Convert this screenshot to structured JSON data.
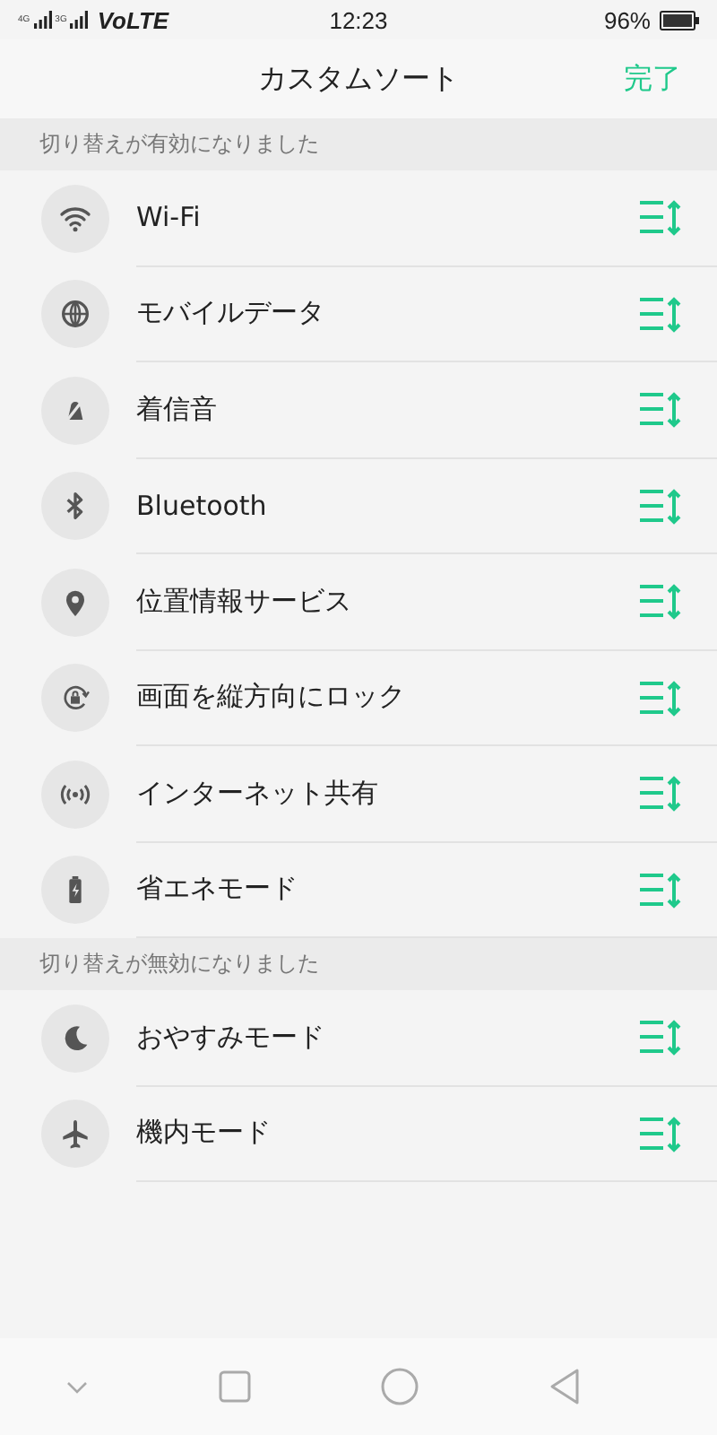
{
  "status_bar": {
    "network_1": "4G",
    "network_2": "3G",
    "carrier": "VoLTE",
    "time": "12:23",
    "battery": "96%"
  },
  "header": {
    "title": "カスタムソート",
    "done": "完了"
  },
  "sections": [
    {
      "title": "切り替えが有効になりました",
      "items": [
        {
          "label": "Wi-Fi",
          "kind": "wifi"
        },
        {
          "label": "モバイルデータ",
          "kind": "globe"
        },
        {
          "label": "着信音",
          "kind": "ringer"
        },
        {
          "label": "Bluetooth",
          "kind": "bluetooth"
        },
        {
          "label": "位置情報サービス",
          "kind": "location"
        },
        {
          "label": "画面を縦方向にロック",
          "kind": "rotation"
        },
        {
          "label": "インターネット共有",
          "kind": "hotspot"
        },
        {
          "label": "省エネモード",
          "kind": "battery"
        }
      ]
    },
    {
      "title": "切り替えが無効になりました",
      "items": [
        {
          "label": "おやすみモード",
          "kind": "moon"
        },
        {
          "label": "機内モード",
          "kind": "airplane"
        }
      ]
    }
  ]
}
